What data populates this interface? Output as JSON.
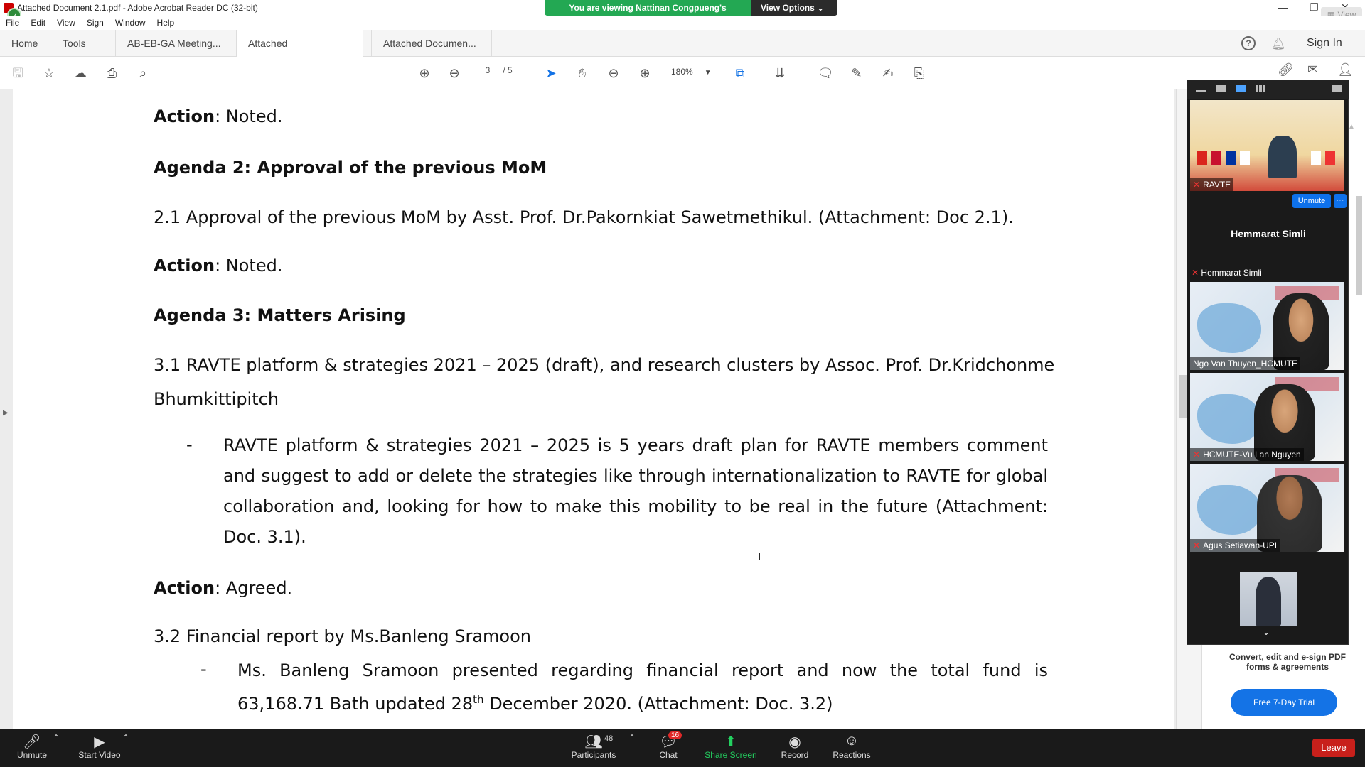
{
  "window": {
    "title": "Attached Document 2.1.pdf - Adobe Acrobat Reader DC (32-bit)",
    "view_label": "View"
  },
  "share_banner": {
    "viewing_text": "You are viewing Nattinan Congpueng's screen",
    "view_options": "View Options"
  },
  "menu": [
    "File",
    "Edit",
    "View",
    "Sign",
    "Window",
    "Help"
  ],
  "tabs": {
    "home": "Home",
    "tools": "Tools",
    "doc1": "AB-EB-GA Meeting...",
    "doc2": "Attached Documen...",
    "doc3": "Attached Documen...",
    "close": "×",
    "signin": "Sign In"
  },
  "toolbar": {
    "page_current": "3",
    "page_total": "/ 5",
    "zoom": "180%"
  },
  "document": {
    "line1_label": "Action",
    "line1_value": ": Noted.",
    "agenda2": "Agenda 2: Approval of the previous MoM",
    "item21": "2.1 Approval of the previous MoM by Asst. Prof. Dr.Pakornkiat Sawetmethikul. (Attachment: Doc 2.1).",
    "action2_label": "Action",
    "action2_value": ": Noted.",
    "agenda3": "Agenda 3: Matters Arising",
    "item31_line1": "3.1 RAVTE platform & strategies 2021 – 2025 (draft), and research clusters by Assoc. Prof. Dr.Kridchonme",
    "item31_line2": "Bhumkittipitch",
    "bullet_dash": "-",
    "para31": "RAVTE platform & strategies 2021 – 2025 is 5 years draft plan for RAVTE members comment and suggest to add or delete the strategies like through internationalization to RAVTE for global collaboration and, looking for how to make this mobility to be real in the future (Attachment: Doc. 3.1).",
    "action3_label": "Action",
    "action3_value": ":  Agreed.",
    "item32": "3.2  Financial report by Ms.Banleng Sramoon",
    "para32_a": "Ms. Banleng Sramoon presented regarding financial report and now the total fund is",
    "para32_b_pre": "63,168.71 Bath updated 28",
    "para32_b_sup": "th",
    "para32_b_post": " December 2020. (Attachment: Doc. 3.2)"
  },
  "ad": {
    "convert_text": "Convert, edit and e-sign PDF forms & agreements",
    "trial_button": "Free 7-Day Trial"
  },
  "gallery": {
    "tile1_label": "RAVTE",
    "unmute": "Unmute",
    "more": "···",
    "active_name": "Hemmarat Simli",
    "active_label": "Hemmarat Simli",
    "tile2_label": "Ngo Van Thuyen_HCMUTE",
    "tile3_label": "HCMUTE-Vu Lan Nguyen",
    "tile4_label": "Agus Setiawan-UPI"
  },
  "zoombar": {
    "unmute": "Unmute",
    "start_video": "Start Video",
    "participants": "Participants",
    "participants_count": "48",
    "chat": "Chat",
    "chat_badge": "16",
    "share_screen": "Share Screen",
    "record": "Record",
    "reactions": "Reactions",
    "leave": "Leave"
  }
}
